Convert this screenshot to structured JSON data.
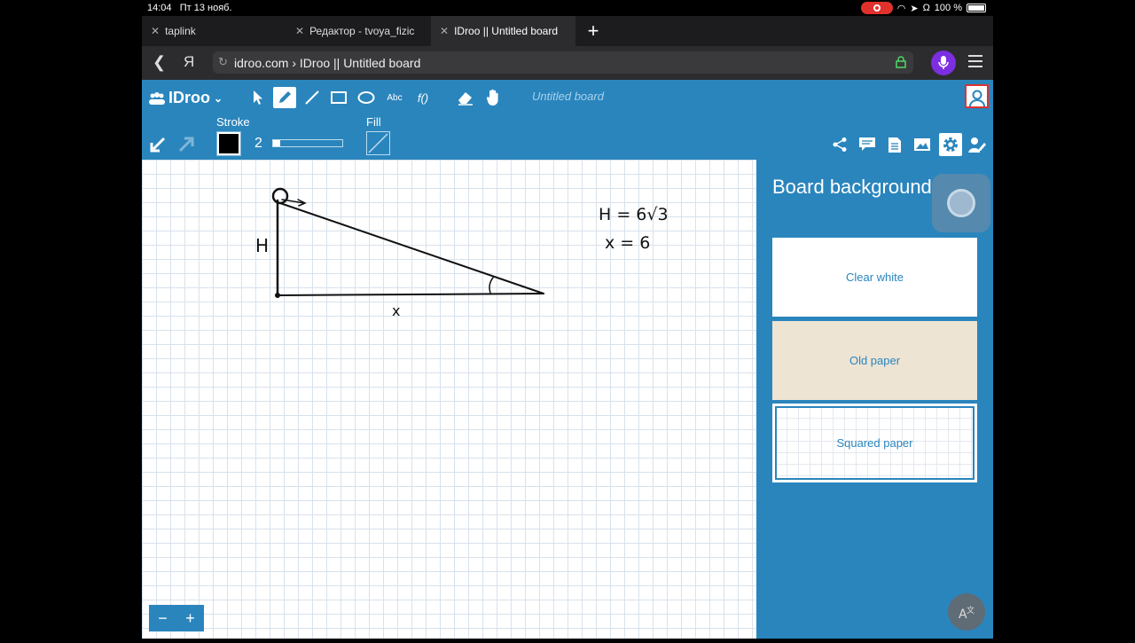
{
  "status": {
    "time": "14:04",
    "date": "Пт 13 нояб.",
    "battery": "100 %"
  },
  "tabs": [
    {
      "label": "taplink"
    },
    {
      "label": "Редактор - tvoya_fizic"
    },
    {
      "label": "IDroo || Untitled board"
    }
  ],
  "browser": {
    "search_engine": "Я",
    "url": "idroo.com › IDroo || Untitled board"
  },
  "app": {
    "logo": "IDroo",
    "board_title": "Untitled board",
    "stroke_label": "Stroke",
    "fill_label": "Fill",
    "stroke_size": "2",
    "stroke_color": "#000000",
    "accent": "#2a85bd",
    "tools": [
      "select-icon",
      "pencil-icon",
      "line-icon",
      "rectangle-icon",
      "ellipse-icon",
      "text-icon",
      "formula-icon",
      "eraser-icon",
      "hand-icon"
    ],
    "text_tool_label": "Abc",
    "formula_tool_label": "f()"
  },
  "panel": {
    "title": "Board background",
    "options": [
      "Clear white",
      "Old paper",
      "Squared paper"
    ],
    "selected": "Squared paper"
  },
  "drawing": {
    "label_h": "H",
    "label_x": "x",
    "eq1": "H = 6√3",
    "eq2": "x = 6"
  },
  "zoom": {
    "minus": "−",
    "plus": "+"
  }
}
